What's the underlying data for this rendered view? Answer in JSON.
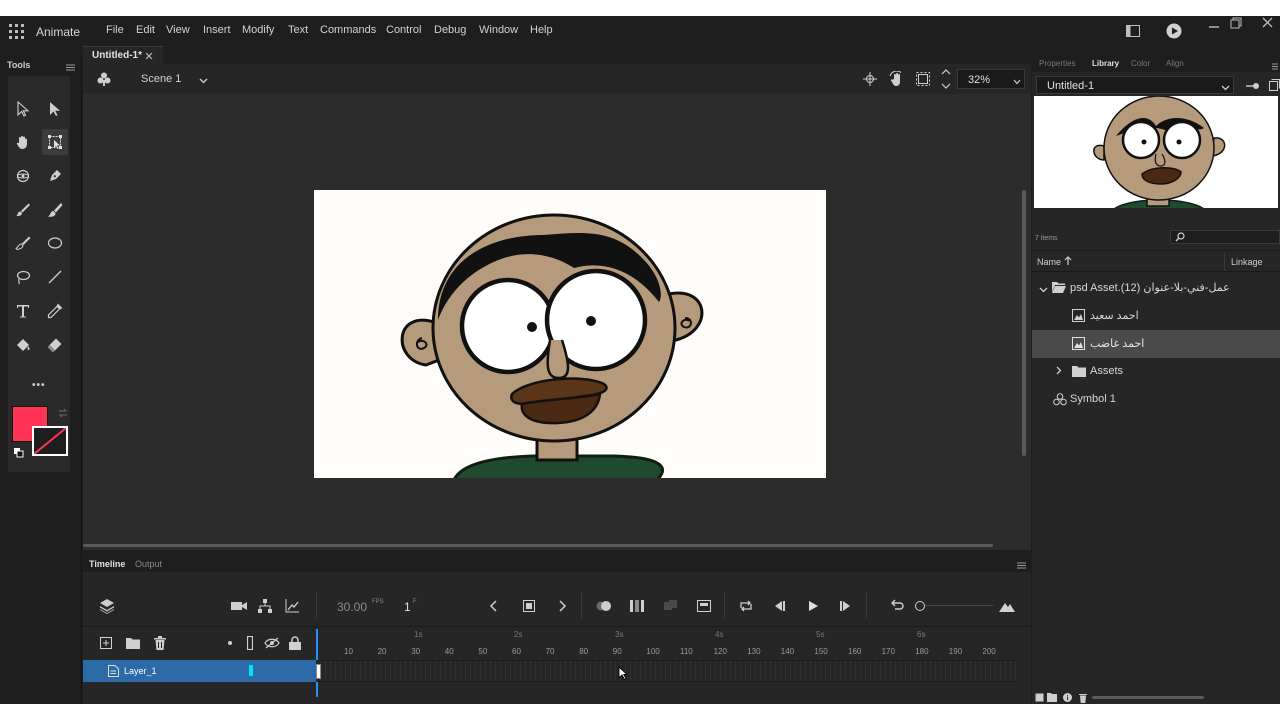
{
  "app": {
    "name": "Animate",
    "menu": [
      "File",
      "Edit",
      "View",
      "Insert",
      "Modify",
      "Text",
      "Commands",
      "Control",
      "Debug",
      "Window",
      "Help"
    ]
  },
  "tools": {
    "title": "Tools",
    "more": "•••",
    "fill_color": "#ff3355",
    "stroke_color": "#1e1e1e"
  },
  "document": {
    "tab_label": "Untitled-1*",
    "scene": "Scene 1",
    "zoom": "32%"
  },
  "timeline": {
    "tabs": [
      "Timeline",
      "Output"
    ],
    "fps": "30.00",
    "fps_unit": "FPS",
    "frame": "1",
    "frame_unit": "F",
    "seconds": [
      "1s",
      "2s",
      "3s",
      "4s",
      "5s",
      "6s"
    ],
    "frames": [
      "10",
      "20",
      "30",
      "40",
      "50",
      "60",
      "70",
      "80",
      "90",
      "100",
      "110",
      "120",
      "130",
      "140",
      "150",
      "160",
      "170",
      "180",
      "190",
      "200"
    ],
    "layer_name": "Layer_1"
  },
  "library": {
    "tabs": [
      "Properties",
      "Library",
      "Color",
      "Align"
    ],
    "document": "Untitled-1",
    "item_count": "7 items",
    "col_name": "Name",
    "col_linkage": "Linkage",
    "items": [
      {
        "label": "psd Asset.(عمل-فني-بلا-عنوان (12",
        "type": "folder",
        "expanded": true
      },
      {
        "label": "احمد سعيد",
        "type": "bitmap"
      },
      {
        "label": "احمد غاضب",
        "type": "bitmap",
        "selected": true
      },
      {
        "label": "Assets",
        "type": "folder",
        "expanded": false
      },
      {
        "label": "Symbol 1",
        "type": "symbol"
      }
    ]
  },
  "colors": {
    "accent_blue": "#2d6aa8",
    "layer_color": "#00e5ff",
    "stage": "#fefdfa",
    "skin": "#b59a7b",
    "mouth": "#5a3518",
    "shirt": "#1f4a2e"
  }
}
